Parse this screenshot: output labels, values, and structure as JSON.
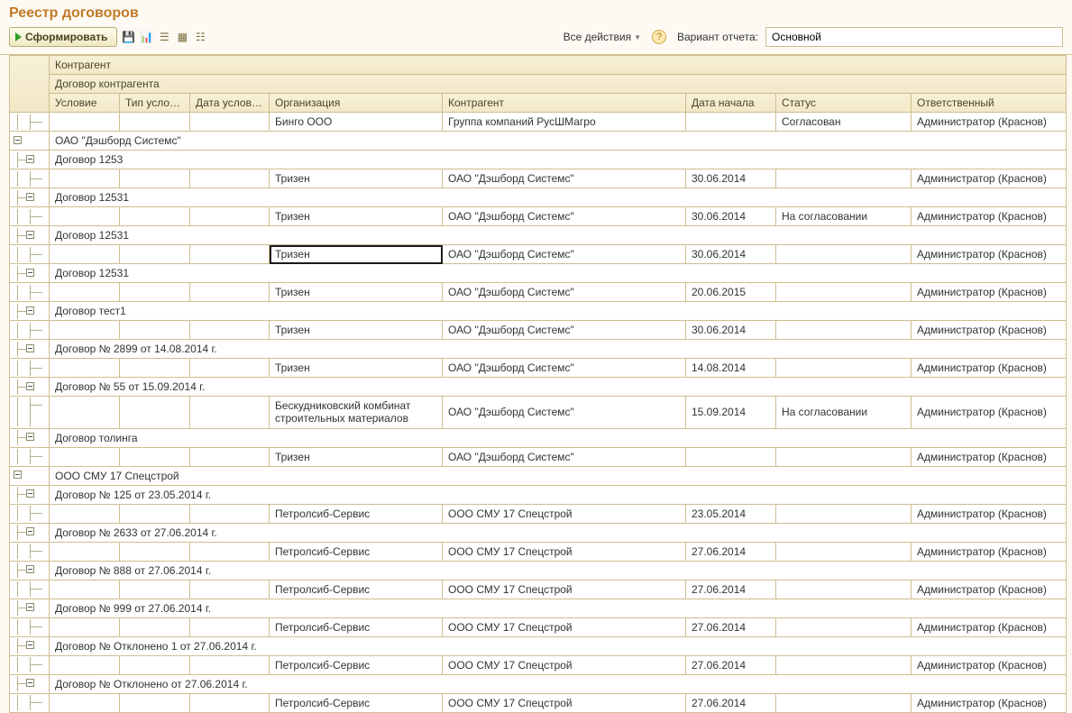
{
  "title": "Реестр договоров",
  "toolbar": {
    "form_label": "Сформировать",
    "all_actions_label": "Все действия",
    "variant_label": "Вариант отчета:",
    "variant_value": "Основной"
  },
  "headers": {
    "kontragent_top": "Контрагент",
    "dogovor_top": "Договор контрагента",
    "uslovie": "Условие",
    "tip": "Тип условий",
    "data_usl": "Дата условия",
    "org": "Организация",
    "kontragent": "Контрагент",
    "data_start": "Дата начала",
    "status": "Статус",
    "otv": "Ответственный"
  },
  "rows": [
    {
      "type": "leaf",
      "level": 2,
      "org": "Бинго ООО",
      "kontragent": "Группа компаний РусШМагро",
      "status": "Согласован",
      "otv": "Администратор (Краснов)"
    },
    {
      "type": "group",
      "level": 0,
      "label": "ОАО \"Дэшборд Системс\""
    },
    {
      "type": "group",
      "level": 1,
      "label": "Договор  1253"
    },
    {
      "type": "leaf",
      "level": 2,
      "org": "Тризен",
      "kontragent": "ОАО \"Дэшборд Системс\"",
      "date": "30.06.2014",
      "otv": "Администратор (Краснов)"
    },
    {
      "type": "group",
      "level": 1,
      "label": "Договор  12531"
    },
    {
      "type": "leaf",
      "level": 2,
      "org": "Тризен",
      "kontragent": "ОАО \"Дэшборд Системс\"",
      "date": "30.06.2014",
      "status": "На согласовании",
      "otv": "Администратор (Краснов)"
    },
    {
      "type": "group",
      "level": 1,
      "label": "Договор  12531"
    },
    {
      "type": "leaf",
      "level": 2,
      "selected": true,
      "org": "Тризен",
      "kontragent": "ОАО \"Дэшборд Системс\"",
      "date": "30.06.2014",
      "otv": "Администратор (Краснов)"
    },
    {
      "type": "group",
      "level": 1,
      "label": "Договор  12531"
    },
    {
      "type": "leaf",
      "level": 2,
      "org": "Тризен",
      "kontragent": "ОАО \"Дэшборд Системс\"",
      "date": "20.06.2015",
      "otv": "Администратор (Краснов)"
    },
    {
      "type": "group",
      "level": 1,
      "label": "Договор  тест1"
    },
    {
      "type": "leaf",
      "level": 2,
      "org": "Тризен",
      "kontragent": "ОАО \"Дэшборд Системс\"",
      "date": "30.06.2014",
      "otv": "Администратор (Краснов)"
    },
    {
      "type": "group",
      "level": 1,
      "label": "Договор № 2899 от 14.08.2014 г."
    },
    {
      "type": "leaf",
      "level": 2,
      "org": "Тризен",
      "kontragent": "ОАО \"Дэшборд Системс\"",
      "date": "14.08.2014",
      "otv": "Администратор (Краснов)"
    },
    {
      "type": "group",
      "level": 1,
      "label": "Договор № 55 от 15.09.2014 г."
    },
    {
      "type": "leaf",
      "level": 2,
      "org": "Бескудниковский комбинат строительных материалов",
      "kontragent": "ОАО \"Дэшборд Системс\"",
      "date": "15.09.2014",
      "status": "На согласовании",
      "otv": "Администратор (Краснов)",
      "tall": true
    },
    {
      "type": "group",
      "level": 1,
      "label": "Договор толинга"
    },
    {
      "type": "leaf",
      "level": 2,
      "org": "Тризен",
      "kontragent": "ОАО \"Дэшборд Системс\"",
      "otv": "Администратор (Краснов)"
    },
    {
      "type": "group",
      "level": 0,
      "label": "ООО СМУ 17 Спецстрой"
    },
    {
      "type": "group",
      "level": 1,
      "label": "Договор № 125 от 23.05.2014 г."
    },
    {
      "type": "leaf",
      "level": 2,
      "org": "Петролсиб-Сервис",
      "kontragent": "ООО СМУ 17 Спецстрой",
      "date": "23.05.2014",
      "otv": "Администратор (Краснов)"
    },
    {
      "type": "group",
      "level": 1,
      "label": "Договор № 2633 от 27.06.2014 г."
    },
    {
      "type": "leaf",
      "level": 2,
      "org": "Петролсиб-Сервис",
      "kontragent": "ООО СМУ 17 Спецстрой",
      "date": "27.06.2014",
      "otv": "Администратор (Краснов)"
    },
    {
      "type": "group",
      "level": 1,
      "label": "Договор № 888 от 27.06.2014 г."
    },
    {
      "type": "leaf",
      "level": 2,
      "org": "Петролсиб-Сервис",
      "kontragent": "ООО СМУ 17 Спецстрой",
      "date": "27.06.2014",
      "otv": "Администратор (Краснов)"
    },
    {
      "type": "group",
      "level": 1,
      "label": "Договор № 999 от 27.06.2014 г."
    },
    {
      "type": "leaf",
      "level": 2,
      "org": "Петролсиб-Сервис",
      "kontragent": "ООО СМУ 17 Спецстрой",
      "date": "27.06.2014",
      "otv": "Администратор (Краснов)"
    },
    {
      "type": "group",
      "level": 1,
      "label": "Договор № Отклонено 1 от 27.06.2014 г."
    },
    {
      "type": "leaf",
      "level": 2,
      "org": "Петролсиб-Сервис",
      "kontragent": "ООО СМУ 17 Спецстрой",
      "date": "27.06.2014",
      "otv": "Администратор (Краснов)"
    },
    {
      "type": "group",
      "level": 1,
      "label": "Договор № Отклонено от 27.06.2014 г."
    },
    {
      "type": "leaf",
      "level": 2,
      "org": "Петролсиб-Сервис",
      "kontragent": "ООО СМУ 17 Спецстрой",
      "date": "27.06.2014",
      "otv": "Администратор (Краснов)"
    }
  ]
}
